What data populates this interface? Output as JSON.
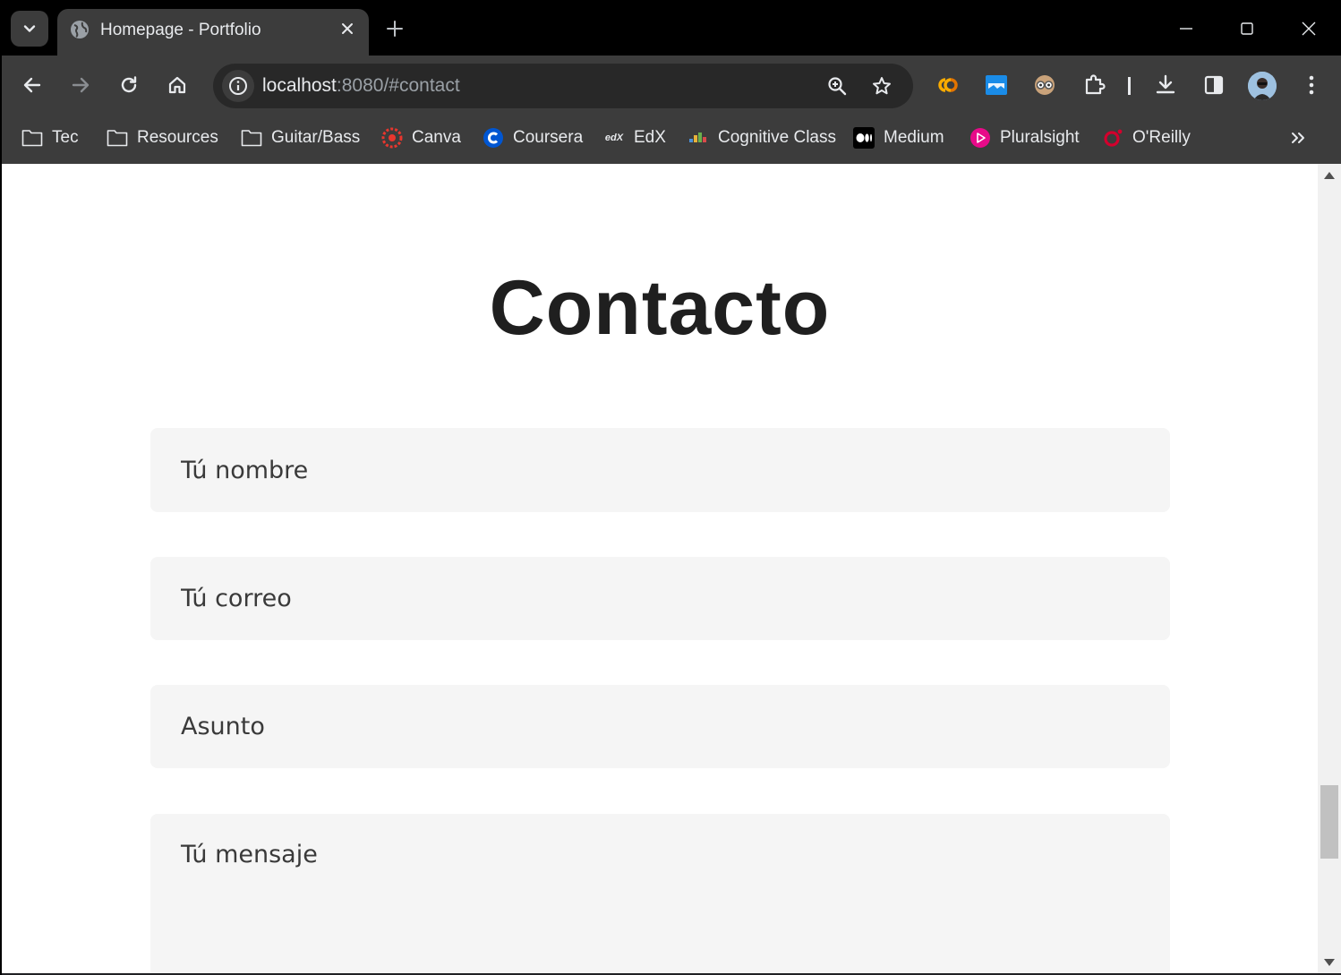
{
  "browser": {
    "tab_title": "Homepage - Portfolio",
    "url_host": "localhost",
    "url_rest": ":8080/#contact"
  },
  "bookmarks": [
    {
      "label": "Tec",
      "icon": "folder-icon"
    },
    {
      "label": "Resources",
      "icon": "folder-icon"
    },
    {
      "label": "Guitar/Bass",
      "icon": "folder-icon"
    },
    {
      "label": "Canva",
      "icon": "canva-icon"
    },
    {
      "label": "Coursera",
      "icon": "coursera-icon"
    },
    {
      "label": "EdX",
      "icon": "edx-icon"
    },
    {
      "label": "Cognitive Class",
      "icon": "cognitive-class-icon"
    },
    {
      "label": "Medium",
      "icon": "medium-icon"
    },
    {
      "label": "Pluralsight",
      "icon": "pluralsight-icon"
    },
    {
      "label": "O'Reilly",
      "icon": "oreilly-icon"
    }
  ],
  "edx_icon_text": "edX",
  "contact": {
    "title": "Contacto",
    "name_placeholder": "Tú nombre",
    "email_placeholder": "Tú correo",
    "subject_placeholder": "Asunto",
    "message_placeholder": "Tú mensaje"
  },
  "colors": {
    "chrome_bg": "#3c3c3c",
    "tab_strip_bg": "#000000",
    "field_bg": "#f5f5f5",
    "title_color": "#1f1f1f"
  }
}
